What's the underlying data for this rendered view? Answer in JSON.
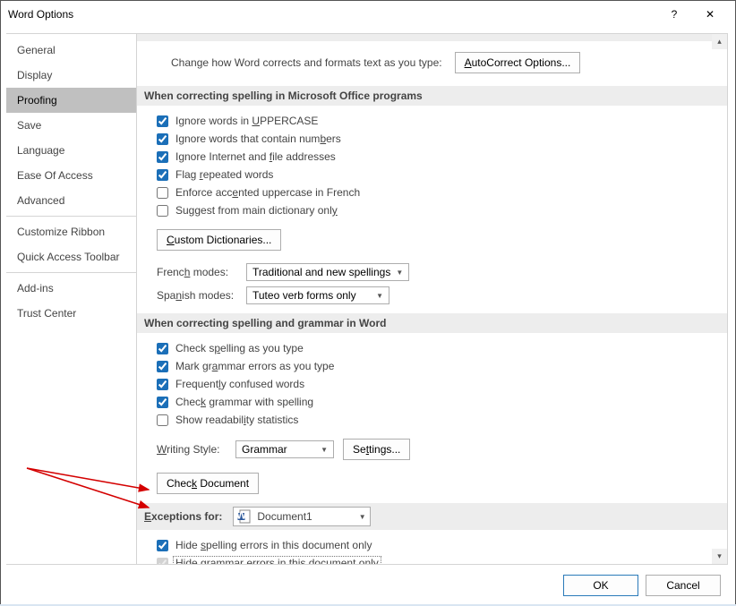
{
  "titlebar": {
    "title": "Word Options"
  },
  "sidebar": {
    "items": [
      {
        "label": "General"
      },
      {
        "label": "Display"
      },
      {
        "label": "Proofing",
        "selected": true
      },
      {
        "label": "Save"
      },
      {
        "label": "Language"
      },
      {
        "label": "Ease Of Access"
      },
      {
        "label": "Advanced"
      }
    ],
    "group2": [
      {
        "label": "Customize Ribbon"
      },
      {
        "label": "Quick Access Toolbar"
      }
    ],
    "group3": [
      {
        "label": "Add-ins"
      },
      {
        "label": "Trust Center"
      }
    ]
  },
  "intro": {
    "text": "Change how Word corrects and formats text as you type:",
    "button": "AutoCorrect Options..."
  },
  "sec1": {
    "header": "When correcting spelling in Microsoft Office programs",
    "ignoreUpper": "Ignore words in UPPERCASE",
    "ignoreNumbers": "Ignore words that contain numbers",
    "ignoreInternet": "Ignore Internet and file addresses",
    "flagRepeated": "Flag repeated words",
    "enforceFrench": "Enforce accented uppercase in French",
    "suggestMain": "Suggest from main dictionary only",
    "customDict": "Custom Dictionaries...",
    "frenchLabel": "French modes:",
    "frenchValue": "Traditional and new spellings",
    "spanishLabel": "Spanish modes:",
    "spanishValue": "Tuteo verb forms only"
  },
  "sec2": {
    "header": "When correcting spelling and grammar in Word",
    "checkSpelling": "Check spelling as you type",
    "markGrammar": "Mark grammar errors as you type",
    "freqConfused": "Frequently confused words",
    "checkGrammar": "Check grammar with spelling",
    "readability": "Show readability statistics",
    "writingStyleLbl": "Writing Style:",
    "writingStyleVal": "Grammar",
    "settingsBtn": "Settings...",
    "checkDocBtn": "Check Document"
  },
  "sec3": {
    "header": "Exceptions for:",
    "docName": "Document1",
    "hideSpelling": "Hide spelling errors in this document only",
    "hideGrammar": "Hide grammar errors in this document only"
  },
  "footer": {
    "ok": "OK",
    "cancel": "Cancel"
  }
}
